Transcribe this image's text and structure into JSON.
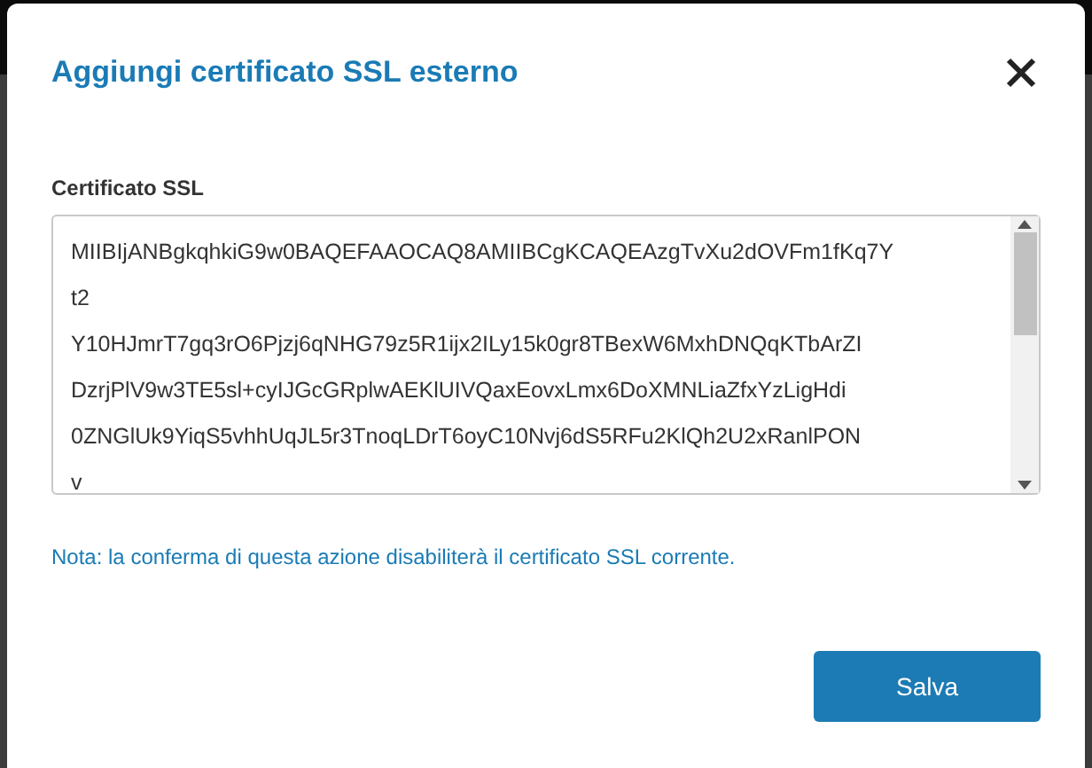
{
  "dialog": {
    "title": "Aggiungi certificato SSL esterno"
  },
  "certificate_field": {
    "label": "Certificato SSL",
    "lines": [
      "MIIBIjANBgkqhkiG9w0BAQEFAAOCAQ8AMIIBCgKCAQEAzgTvXu2dOVFm1fKq7Y",
      "t2",
      "Y10HJmrT7gq3rO6Pjzj6qNHG79z5R1ijx2ILy15k0gr8TBexW6MxhDNQqKTbArZI",
      "DzrjPlV9w3TE5sl+cyIJGcGRplwAEKlUIVQaxEovxLmx6DoXMNLiaZfxYzLigHdi",
      "0ZNGlUk9YiqS5vhhUqJL5r3TnoqLDrT6oyC10Nvj6dS5RFu2KlQh2U2xRanlPON",
      "v"
    ]
  },
  "note": "Nota: la conferma di questa azione disabiliterà il certificato SSL corrente.",
  "buttons": [
    {
      "label": "Salva",
      "kind": "primary"
    }
  ]
}
